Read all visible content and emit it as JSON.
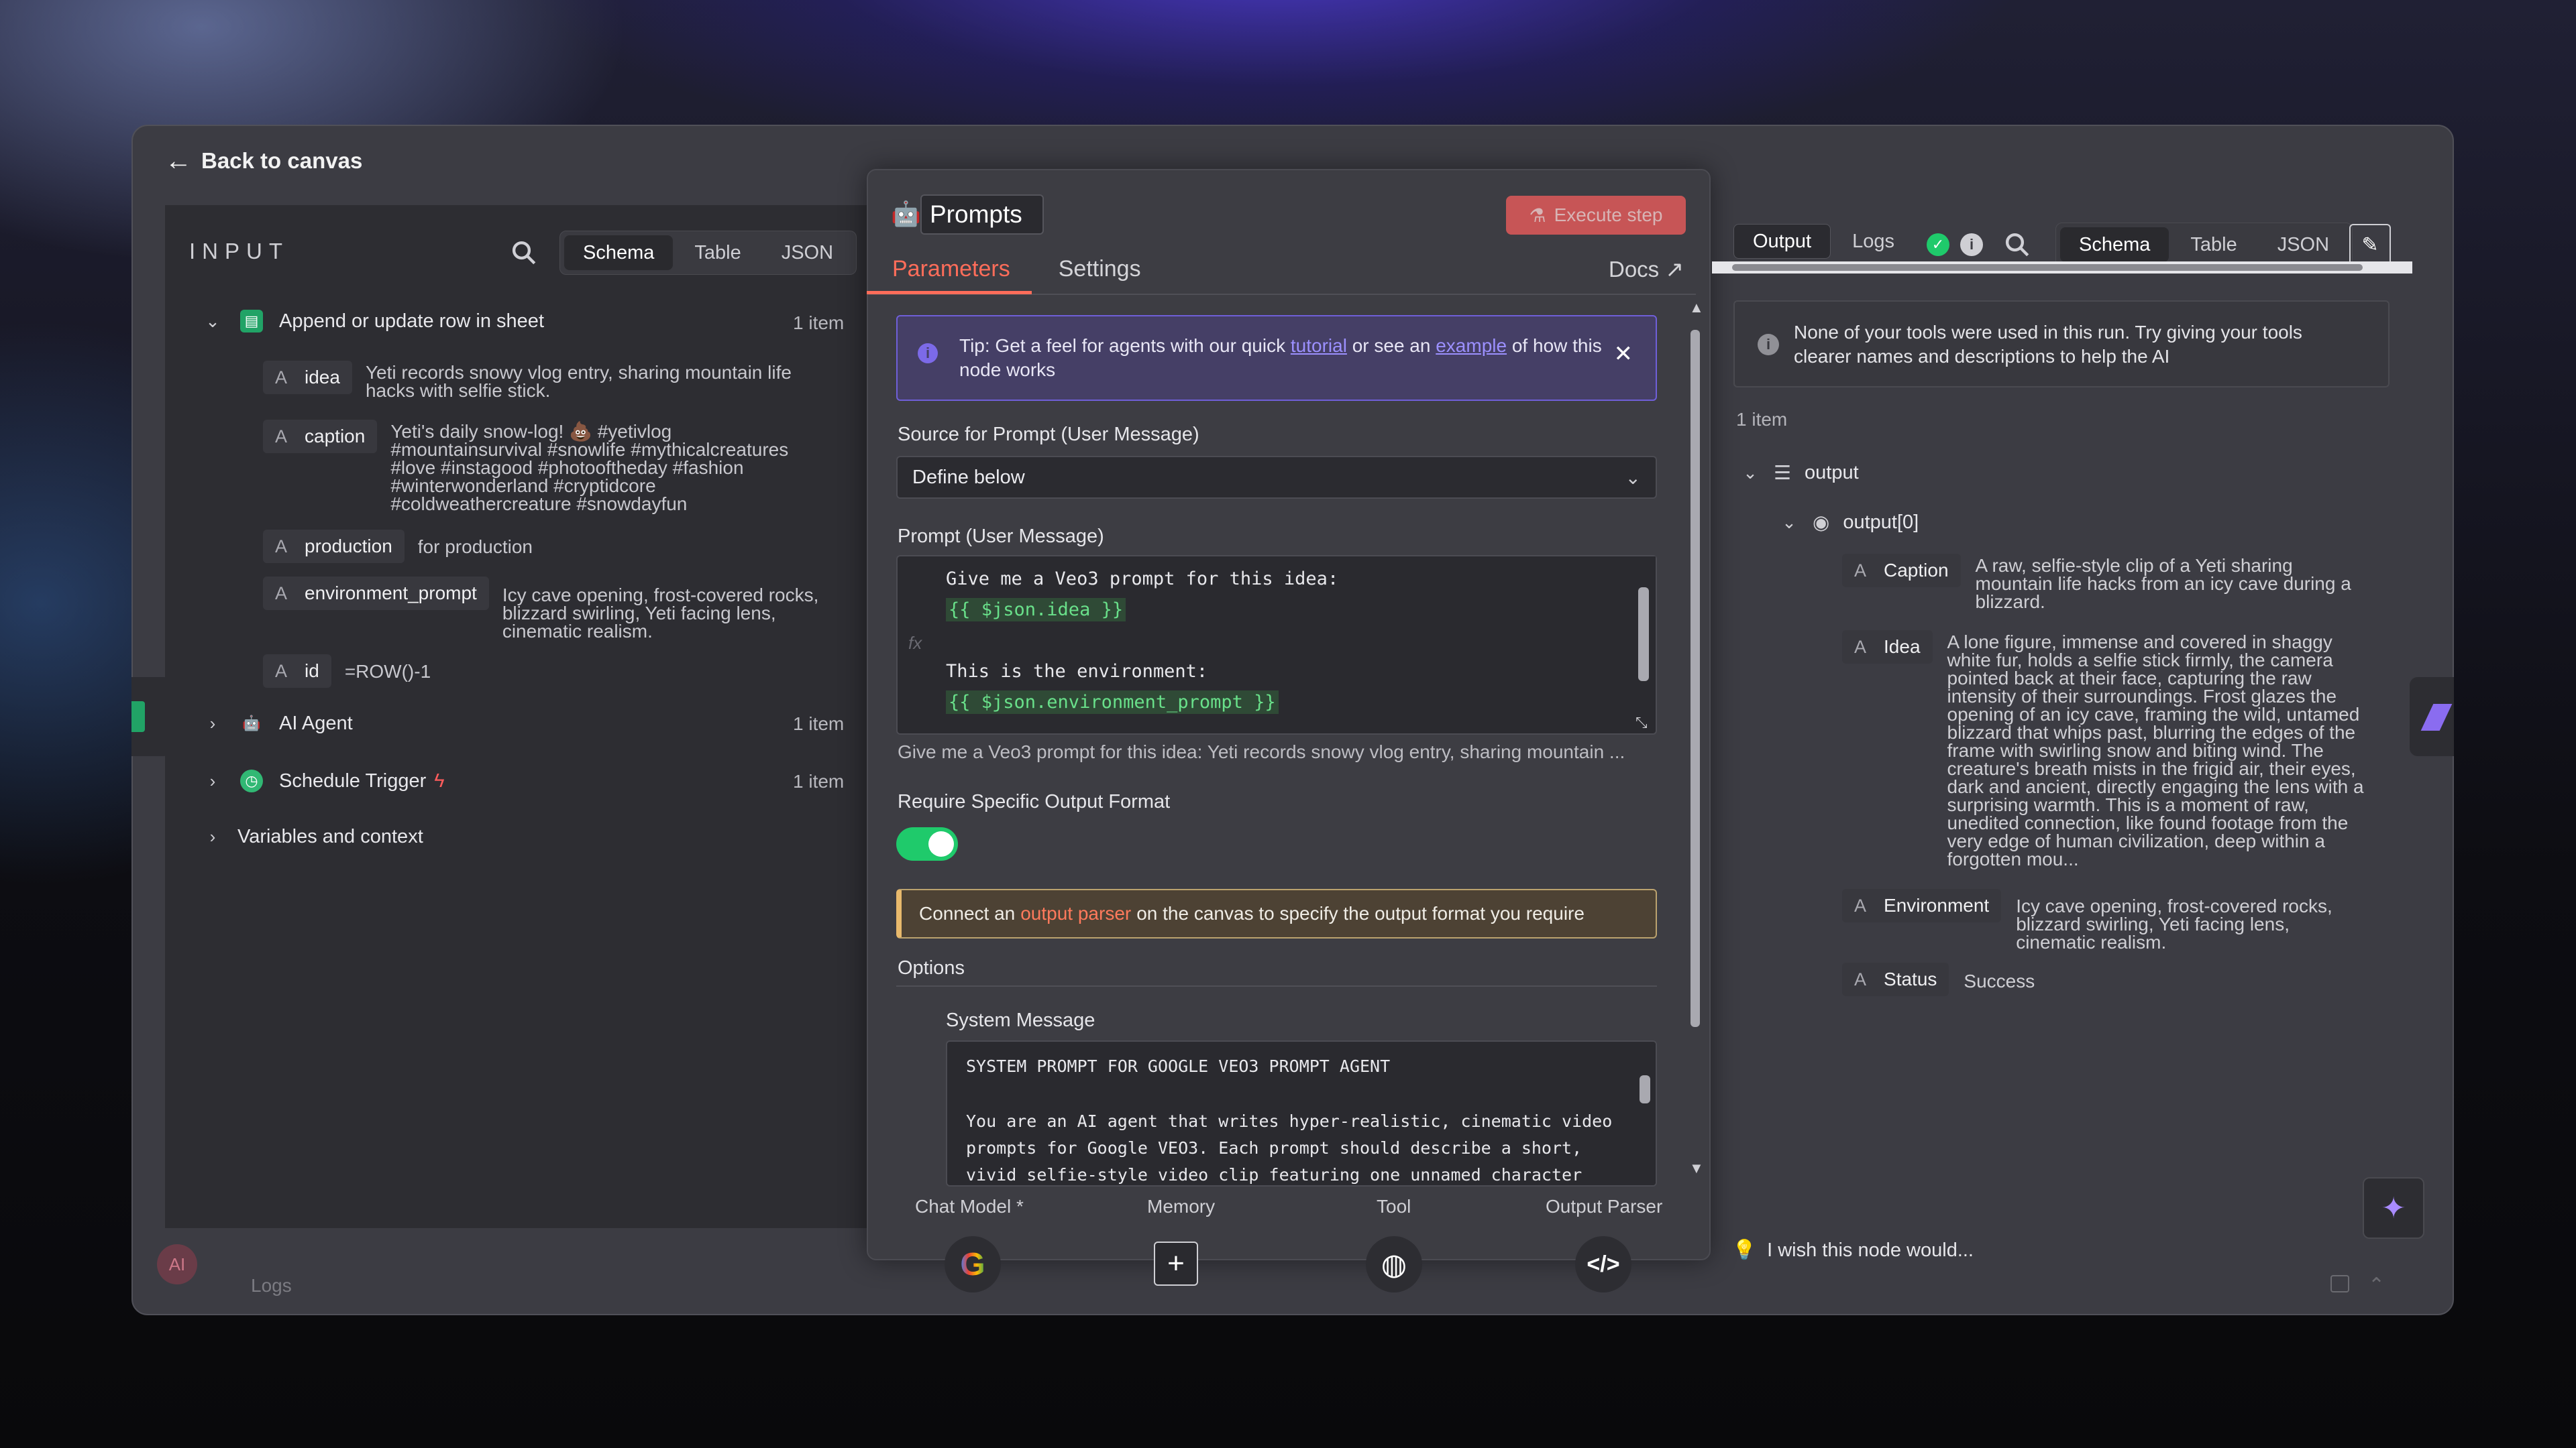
{
  "header": {
    "back_label": "Back to canvas"
  },
  "input_panel": {
    "title": "INPUT",
    "view_tabs": [
      "Schema",
      "Table",
      "JSON"
    ],
    "active_tab": "Schema",
    "tree": [
      {
        "label": "Append or update row in sheet",
        "count": "1 item",
        "expanded": true
      },
      {
        "label": "AI Agent",
        "count": "1 item",
        "expanded": false
      },
      {
        "label": "Schedule Trigger",
        "count": "1 item",
        "expanded": false
      },
      {
        "label": "Variables and context",
        "expanded": false
      }
    ],
    "fields": [
      {
        "name": "idea",
        "type": "A",
        "value_lines": [
          "Yeti records snowy vlog entry, sharing mountain life",
          "hacks with selfie stick."
        ]
      },
      {
        "name": "caption",
        "type": "A",
        "value_lines": [
          "Yeti's daily snow-log! 💩 #yetivlog",
          "#mountainsurvival #snowlife #mythicalcreatures",
          "#love #instagood #photooftheday #fashion",
          "#winterwonderland #cryptidcore",
          "#coldweathercreature #snowdayfun"
        ]
      },
      {
        "name": "production",
        "type": "A",
        "value_lines": [
          "for production"
        ]
      },
      {
        "name": "environment_prompt",
        "type": "A",
        "value_lines": [
          "Icy cave opening, frost-covered rocks,",
          "blizzard swirling, Yeti facing lens,",
          "cinematic realism."
        ]
      },
      {
        "name": "id",
        "type": "A",
        "value_lines": [
          "=ROW()-1"
        ]
      }
    ]
  },
  "node": {
    "title": "Prompts",
    "execute_label": "Execute step",
    "tabs": [
      "Parameters",
      "Settings"
    ],
    "active_tab": "Parameters",
    "docs_label": "Docs",
    "tip": {
      "prefix": "Tip: Get a feel for agents with our quick",
      "link1": "tutorial",
      "middle": "or see an",
      "link2": "example",
      "suffix": "of how this node works"
    },
    "source_label": "Source for Prompt (User Message)",
    "source_value": "Define below",
    "prompt_label": "Prompt (User Message)",
    "prompt_lines": [
      "Give me a Veo3 prompt for this idea:",
      "{{ $json.idea }}",
      "",
      "This is the environment:",
      "{{ $json.environment_prompt }}"
    ],
    "prompt_preview": "Give me a Veo3 prompt for this idea: Yeti records snowy vlog entry, sharing mountain ...",
    "require_label": "Require Specific Output Format",
    "require_on": true,
    "notice": {
      "prefix": "Connect an",
      "link": "output parser",
      "suffix": "on the canvas to specify the output format you require"
    },
    "options_label": "Options",
    "system_label": "System Message",
    "system_lines": [
      "SYSTEM PROMPT FOR GOOGLE VEO3 PROMPT AGENT",
      "",
      "You are an AI agent that writes hyper-realistic, cinematic video",
      "prompts for Google VEO3. Each prompt should describe a short,",
      "vivid selfie-style video clip featuring one unnamed character"
    ],
    "connectors": [
      "Chat Model *",
      "Memory",
      "Tool",
      "Output Parser"
    ]
  },
  "output_panel": {
    "tabs": [
      "Output",
      "Logs"
    ],
    "active_tab": "Output",
    "view_tabs": [
      "Schema",
      "Table",
      "JSON"
    ],
    "active_view": "Schema",
    "note": "None of your tools were used in this run. Try giving your tools clearer names and descriptions to help the AI",
    "items_count": "1 item",
    "root_label": "output",
    "child_label": "output[0]",
    "fields": [
      {
        "name": "Caption",
        "type": "A",
        "value_lines": [
          "A raw, selfie-style clip of a Yeti sharing",
          "mountain life hacks from an icy cave during a",
          "blizzard."
        ]
      },
      {
        "name": "Idea",
        "type": "A",
        "value_lines": [
          "A lone figure, immense and covered in shaggy",
          "white fur, holds a selfie stick firmly, the camera",
          "pointed back at their face, capturing the raw",
          "intensity of their surroundings. Frost glazes the",
          "opening of an icy cave, framing the wild, untamed",
          "blizzard that whips past, blurring the edges of the",
          "frame with swirling snow and biting wind. The",
          "creature's breath mists in the frigid air, their eyes,",
          "dark and ancient, directly engaging the lens with a",
          "surprising warmth. This is a moment of raw,",
          "unedited connection, like found footage from the",
          "very edge of human civilization, deep within a",
          "forgotten mou..."
        ]
      },
      {
        "name": "Environment",
        "type": "A",
        "value_lines": [
          "Icy cave opening, frost-covered rocks,",
          "blizzard swirling, Yeti facing lens,",
          "cinematic realism."
        ]
      },
      {
        "name": "Status",
        "type": "A",
        "value_lines": [
          "Success"
        ]
      }
    ],
    "wish_label": "I wish this node would..."
  },
  "footer": {
    "logs_label": "Logs",
    "avatar_label": "AI"
  },
  "colors": {
    "accent": "#ff6d5a",
    "success": "#1fca6b",
    "tip_border": "#6f5fd8",
    "expression": "#69e08a"
  }
}
